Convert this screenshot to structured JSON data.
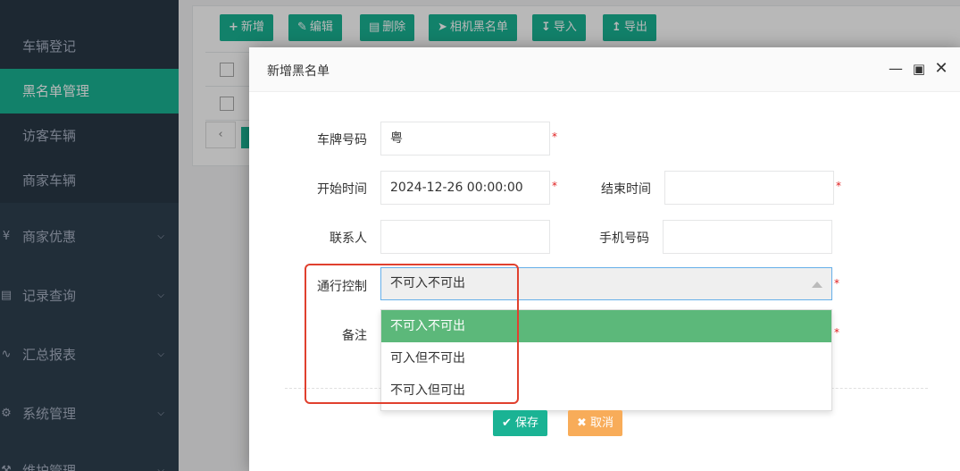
{
  "sidebar": {
    "sub_items": [
      {
        "label": "车辆登记"
      },
      {
        "label": "黑名单管理"
      },
      {
        "label": "访客车辆"
      },
      {
        "label": "商家车辆"
      }
    ],
    "groups": [
      {
        "label": "商家优惠",
        "icon": "coupon-icon"
      },
      {
        "label": "记录查询",
        "icon": "record-icon"
      },
      {
        "label": "汇总报表",
        "icon": "chart-line-icon"
      },
      {
        "label": "系统管理",
        "icon": "gear-icon"
      },
      {
        "label": "维护管理",
        "icon": "wrench-icon"
      }
    ]
  },
  "toolbar": {
    "add": "新增",
    "edit": "编辑",
    "delete": "删除",
    "camera_blacklist": "相机黑名单",
    "import": "导入",
    "export": "导出"
  },
  "modal": {
    "title": "新增黑名单",
    "form": {
      "plate_label": "车牌号码",
      "plate_value": "粤",
      "start_label": "开始时间",
      "start_value": "2024-12-26 00:00:00",
      "end_label": "结束时间",
      "end_value": "",
      "contact_label": "联系人",
      "contact_value": "",
      "phone_label": "手机号码",
      "phone_value": "",
      "control_label": "通行控制",
      "control_value": "不可入不可出",
      "remark_label": "备注",
      "required_mark": "*"
    },
    "control_options": [
      "不可入不可出",
      "可入但不可出",
      "不可入但可出"
    ],
    "save": "保存",
    "cancel": "取消"
  },
  "colors": {
    "sidebar_bg": "#2f4050",
    "accent": "#1ab394",
    "selected_option": "#5cb87a",
    "cancel": "#f8ac59",
    "highlight": "#e0402e"
  }
}
